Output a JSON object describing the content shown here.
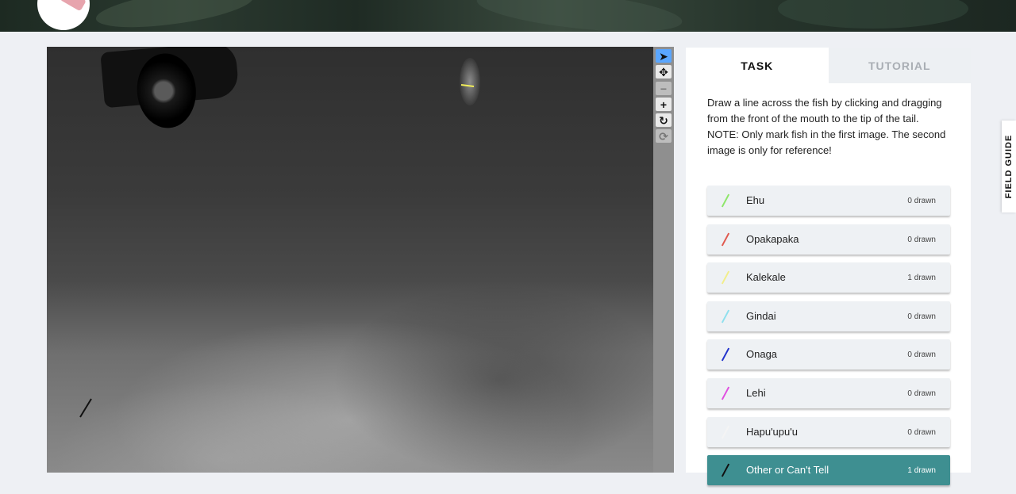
{
  "colors": {
    "accent_selected": "#3e8f91",
    "tool_active": "#5aa6ff"
  },
  "toolbar": {
    "tools": [
      {
        "icon": "pointer-icon",
        "symbol": "➤"
      },
      {
        "icon": "move-icon",
        "symbol": "✥"
      },
      {
        "icon": "zoom-out-icon",
        "symbol": "−"
      },
      {
        "icon": "zoom-in-icon",
        "symbol": "+"
      },
      {
        "icon": "rotate-icon",
        "symbol": "↻"
      },
      {
        "icon": "reset-icon",
        "symbol": "⟳"
      }
    ]
  },
  "task_panel": {
    "tabs": {
      "task": "TASK",
      "tutorial": "TUTORIAL"
    },
    "instructions": {
      "line1": "Draw a line across the fish by clicking and dragging from the front of the mouth to the tip of the tail.",
      "line2": "NOTE: Only mark fish in the first image. The second image is only for reference!"
    },
    "choices": [
      {
        "label": "Ehu",
        "count": "0 drawn",
        "color": "#8ee66a"
      },
      {
        "label": "Opakapaka",
        "count": "0 drawn",
        "color": "#e0594e"
      },
      {
        "label": "Kalekale",
        "count": "1 drawn",
        "color": "#f2ee8a"
      },
      {
        "label": "Gindai",
        "count": "0 drawn",
        "color": "#8fe0ee"
      },
      {
        "label": "Onaga",
        "count": "0 drawn",
        "color": "#2233cc"
      },
      {
        "label": "Lehi",
        "count": "0 drawn",
        "color": "#e04fe0"
      },
      {
        "label": "Hapu'upu'u",
        "count": "0 drawn",
        "color": "#f4f4f4"
      },
      {
        "label": "Other or Can't Tell",
        "count": "1 drawn",
        "color": "#111111"
      }
    ]
  },
  "field_guide": {
    "label": "FIELD GUIDE"
  }
}
